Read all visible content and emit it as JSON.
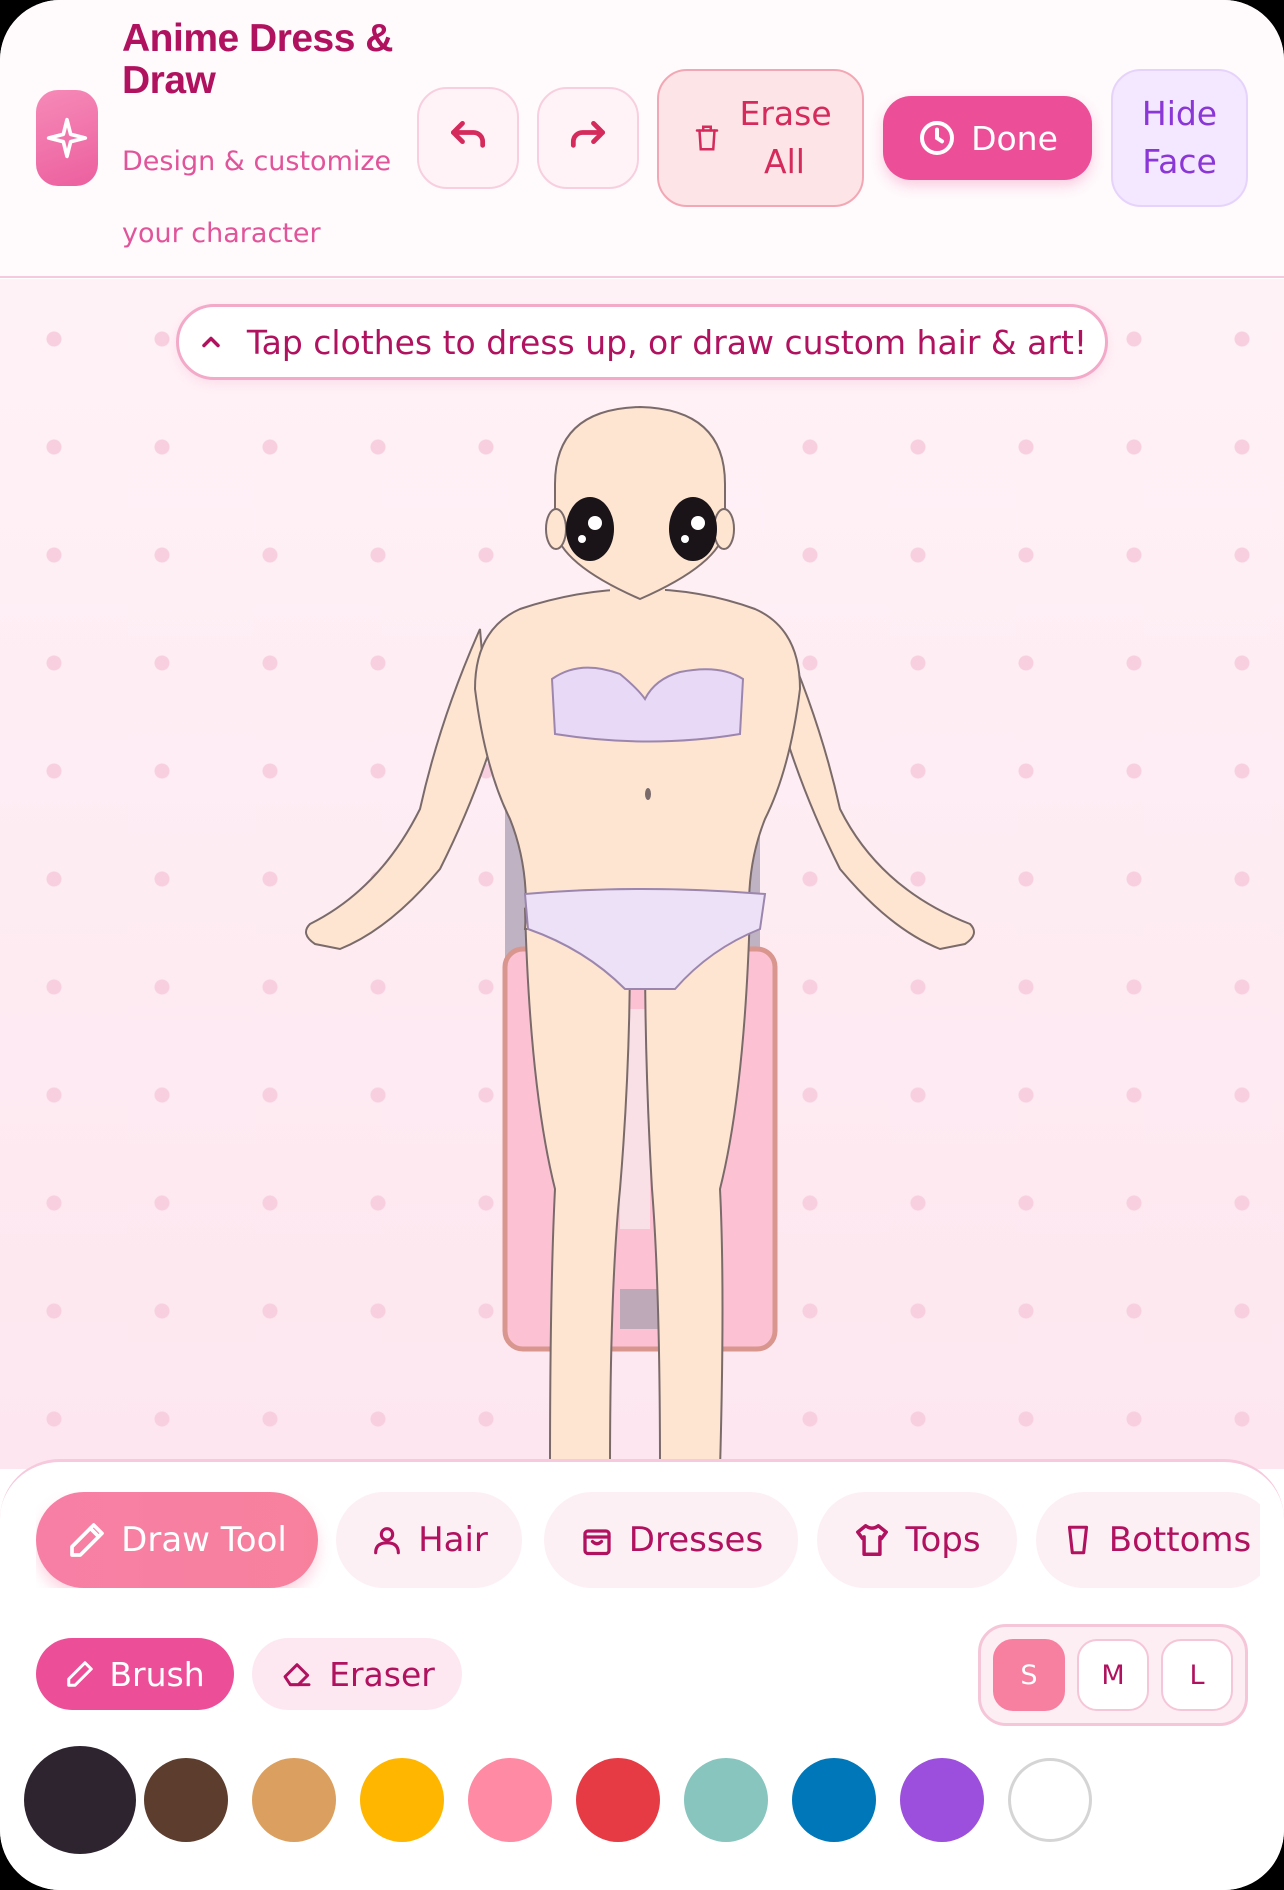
{
  "header": {
    "title": "Anime Dress & Draw",
    "subtitle": "Design & customize your character",
    "erase_label": "Erase All",
    "done_label": "Done",
    "hide_face_label": "Hide Face"
  },
  "stage": {
    "hint": "Tap clothes to dress up, or draw custom hair & art!"
  },
  "tabs": [
    {
      "label": "Draw Tool",
      "icon": "pencil-icon",
      "active": true
    },
    {
      "label": "Hair",
      "icon": "person-icon",
      "active": false
    },
    {
      "label": "Dresses",
      "icon": "bag-icon",
      "active": false
    },
    {
      "label": "Tops",
      "icon": "shirt-icon",
      "active": false
    },
    {
      "label": "Bottoms",
      "icon": "skirt-icon",
      "active": false
    }
  ],
  "tools": {
    "brush_label": "Brush",
    "eraser_label": "Eraser",
    "active": "brush"
  },
  "sizes": {
    "options": [
      "S",
      "M",
      "L"
    ],
    "selected": "S"
  },
  "palette": {
    "colors": [
      "#2e2430",
      "#5c3d2e",
      "#dba060",
      "#ffb600",
      "#ff8aa4",
      "#e63a45",
      "#88c5be",
      "#0077b8",
      "#9b4fdc",
      "#ffffff"
    ],
    "selected": "#2e2430"
  }
}
